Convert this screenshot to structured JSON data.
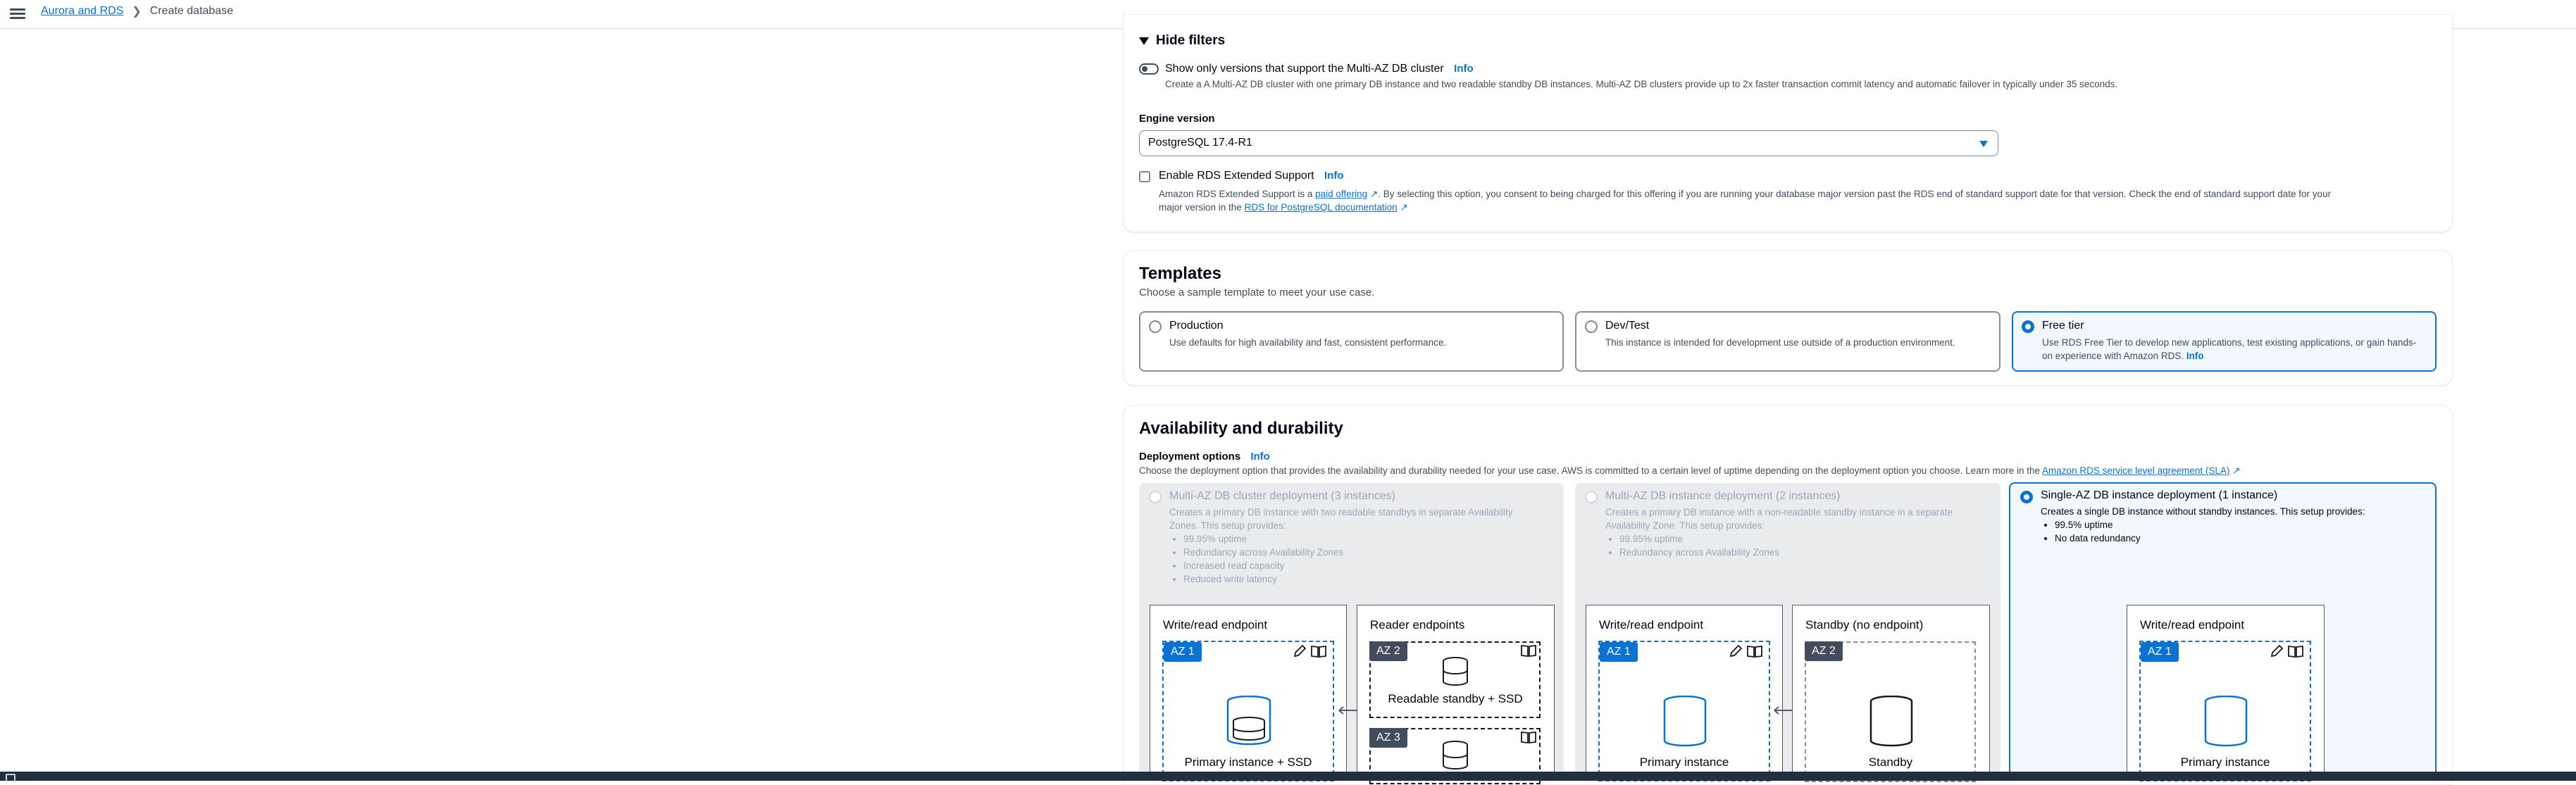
{
  "breadcrumb": {
    "root": "Aurora and RDS",
    "current": "Create database"
  },
  "filters": {
    "heading": "Hide filters",
    "multi_az_toggle_label": "Show only versions that support the Multi-AZ DB cluster",
    "info": "Info",
    "multi_az_toggle_desc": "Create a A Multi-AZ DB cluster with one primary DB instance and two readable standby DB instances. Multi-AZ DB clusters provide up to 2x faster transaction commit latency and automatic failover in typically under 35 seconds.",
    "engine_version_label": "Engine version",
    "engine_version_value": "PostgreSQL 17.4-R1",
    "extended_support_label": "Enable RDS Extended Support",
    "extended_desc_1": "Amazon RDS Extended Support is a",
    "extended_link_1": "paid offering",
    "extended_desc_2": ". By selecting this option, you consent to being charged for this offering if you are running your database major version past the RDS end of standard support date for that version. Check the end of standard support date for your",
    "extended_desc_3": "major version in the",
    "extended_link_2": "RDS for PostgreSQL documentation"
  },
  "templates": {
    "title": "Templates",
    "subtitle": "Choose a sample template to meet your use case.",
    "options": [
      {
        "title": "Production",
        "desc": "Use defaults for high availability and fast, consistent performance.",
        "selected": false
      },
      {
        "title": "Dev/Test",
        "desc": "This instance is intended for development use outside of a production environment.",
        "selected": false
      },
      {
        "title": "Free tier",
        "desc": "Use RDS Free Tier to develop new applications, test existing applications, or gain hands-on experience with Amazon RDS.",
        "info": "Info",
        "selected": true
      }
    ]
  },
  "availability": {
    "title": "Availability and durability",
    "deployment_label": "Deployment options",
    "info": "Info",
    "desc": "Choose the deployment option that provides the availability and durability needed for your use case. AWS is committed to a certain level of uptime depending on the deployment option you choose. Learn more in the",
    "sla_link": "Amazon RDS service level agreement (SLA)",
    "options": [
      {
        "title": "Multi-AZ DB cluster deployment (3 instances)",
        "desc_1": "Creates a primary DB instance with two readable standbys in separate Availability",
        "desc_2": "Zones. This setup provides:",
        "bullets": [
          "99.95% uptime",
          "Redundancy across Availability Zones",
          "Increased read capacity",
          "Reduced write latency"
        ],
        "disabled": true
      },
      {
        "title": "Multi-AZ DB instance deployment (2 instances)",
        "desc_1": "Creates a primary DB instance with a non-readable standby instance in a separate",
        "desc_2": "Availability Zone. This setup provides:",
        "bullets": [
          "99.95% uptime",
          "Redundancy across Availability Zones"
        ],
        "disabled": true
      },
      {
        "title": "Single-AZ DB instance deployment (1 instance)",
        "desc_1": "Creates a single DB instance without standby instances. This setup provides:",
        "bullets": [
          "99.5% uptime",
          "No data redundancy"
        ],
        "selected": true
      }
    ],
    "diagrams": {
      "write_read_endpoint": "Write/read endpoint",
      "reader_endpoints": "Reader endpoints",
      "standby_no_endpoint": "Standby (no endpoint)",
      "az1": "AZ 1",
      "az2": "AZ 2",
      "az3": "AZ 3",
      "primary_ssd": "Primary instance + SSD",
      "readable_standby_ssd": "Readable standby + SSD",
      "primary_instance": "Primary instance",
      "standby": "Standby"
    }
  }
}
